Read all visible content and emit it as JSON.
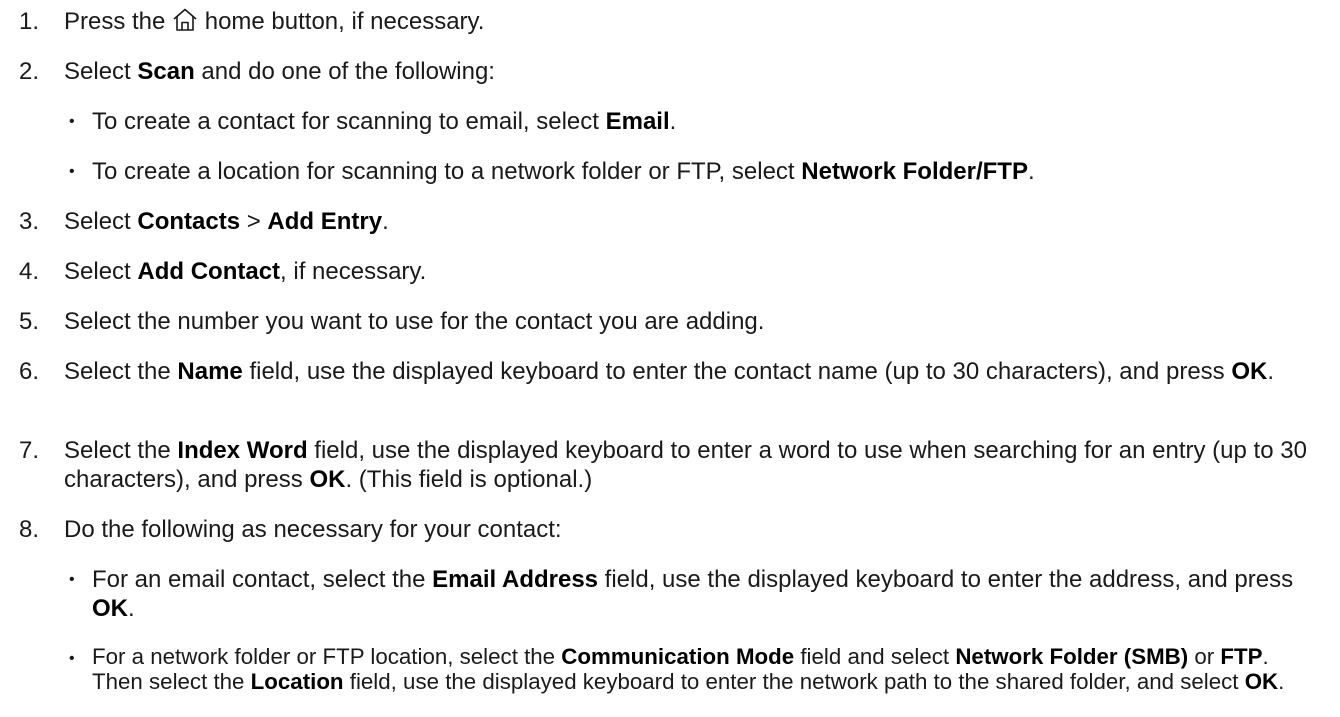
{
  "steps": [
    {
      "num": "1.",
      "parts": {
        "a": "Press the ",
        "icon": "home-icon",
        "b": " home button, if necessary."
      }
    },
    {
      "num": "2.",
      "parts": {
        "a": "Select ",
        "b1": "Scan",
        "c": " and do one of the following:"
      }
    },
    {
      "num": "3.",
      "parts": {
        "a": "Select ",
        "b1": "Contacts",
        "c": " > ",
        "b2": "Add Entry",
        "d": "."
      }
    },
    {
      "num": "4.",
      "parts": {
        "a": "Select ",
        "b1": "Add Contact",
        "c": ", if necessary."
      }
    },
    {
      "num": "5.",
      "parts": {
        "a": "Select the number you want to use for the contact you are adding."
      }
    },
    {
      "num": "6.",
      "parts": {
        "a": "Select the ",
        "b1": "Name",
        "c": " field, use the displayed keyboard to enter the contact name (up to 30 characters), and press ",
        "b2": "OK",
        "d": "."
      }
    },
    {
      "num": "7.",
      "parts": {
        "a": "Select the ",
        "b1": "Index Word",
        "c": " field, use the displayed keyboard to enter a word to use when searching for an entry (up to 30 characters), and press ",
        "b2": "OK",
        "d": ". (This field is optional.)"
      }
    },
    {
      "num": "8.",
      "parts": {
        "a": "Do the following as necessary for your contact:"
      }
    }
  ],
  "step2_bullets": [
    {
      "a": "To create a contact for scanning to email, select ",
      "b1": "Email",
      "c": "."
    },
    {
      "a": "To create a location for scanning to a network folder or FTP, select ",
      "b1": "Network Folder/FTP",
      "c": "."
    }
  ],
  "step8_bullets": [
    {
      "a": "For an email contact, select the ",
      "b1": "Email Address",
      "c": " field, use the displayed keyboard to enter the address, and press ",
      "b2": "OK",
      "d": "."
    },
    {
      "a": "For a network folder or FTP location, select the ",
      "b1": "Communication Mode",
      "c": " field and select ",
      "b2": "Network Folder (SMB)",
      "d": " or ",
      "b3": "FTP",
      "e": ". Then select the ",
      "b4": "Location",
      "f": " field, use the displayed keyboard to enter the network path to the shared folder, and select ",
      "b5": "OK",
      "g": "."
    }
  ],
  "bullet_char": "•"
}
